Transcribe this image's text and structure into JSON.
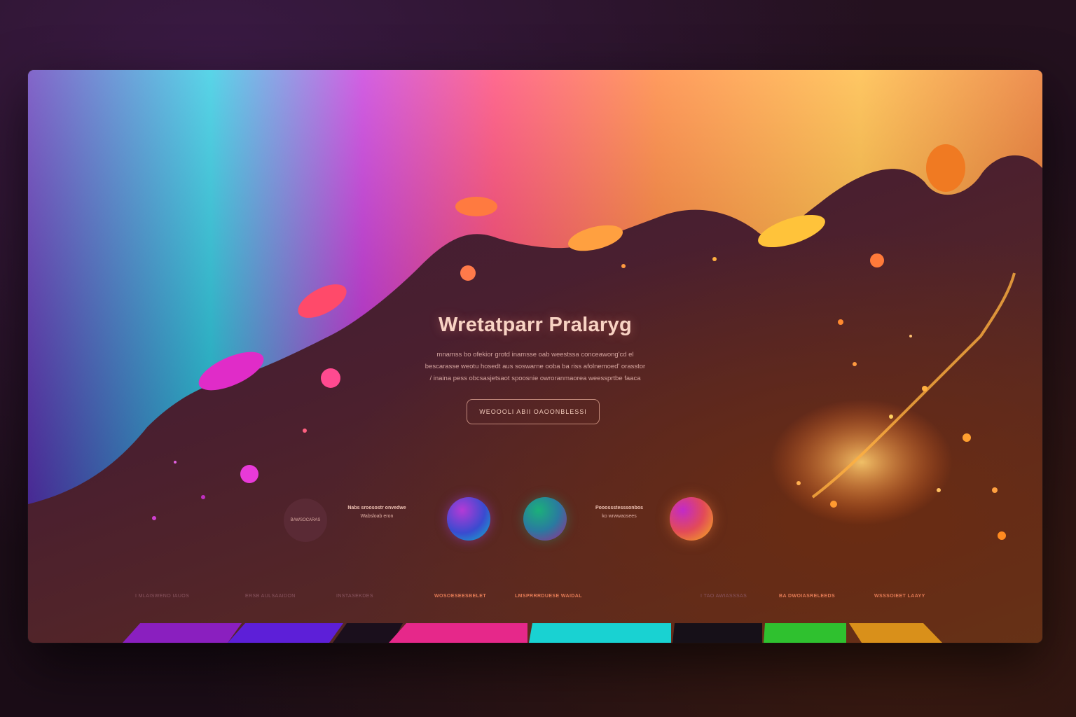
{
  "hero": {
    "headline": "Wretatparr Pralaryg",
    "body_lines": [
      "mnamss bo ofekior grotd inamsse oab weestssa conceawong'cd el",
      "bescarasse weotu hosedt aus soswarne ooba ba riss afolnemoed' orasstor",
      "/ inaina pess obcsasjetsaot spoosnie owroranmaorea weessprtbe faaca"
    ],
    "cta_label": "WEOOOLI  ABII  OAOONBLESSI"
  },
  "features": [
    {
      "circle_label": "BAWSOCARAS",
      "title": "Nabs sroosostr onvedwe",
      "subtitle": "Wabsloab eron"
    },
    {
      "title": "Pooossstesssonbos",
      "subtitle": "ko wrwwaosees"
    }
  ],
  "footer_links": [
    "I MLAISWENO IAUOS",
    "ERSB AULSAAIDON",
    "INSTASEKDES",
    "WOSOESEESBELET",
    "LMSPRRRDUESE WAIDAL",
    "I TAO AWIASSSAS",
    "BA DWOIASRELEEDS",
    "WSSSOIEET LAAYY"
  ],
  "colors": {
    "swatches": [
      "#8a1fbf",
      "#5d1fd8",
      "#1a0f1c",
      "#e6288a",
      "#19d2d2",
      "#161018",
      "#2fc12f",
      "#d9901a"
    ]
  }
}
